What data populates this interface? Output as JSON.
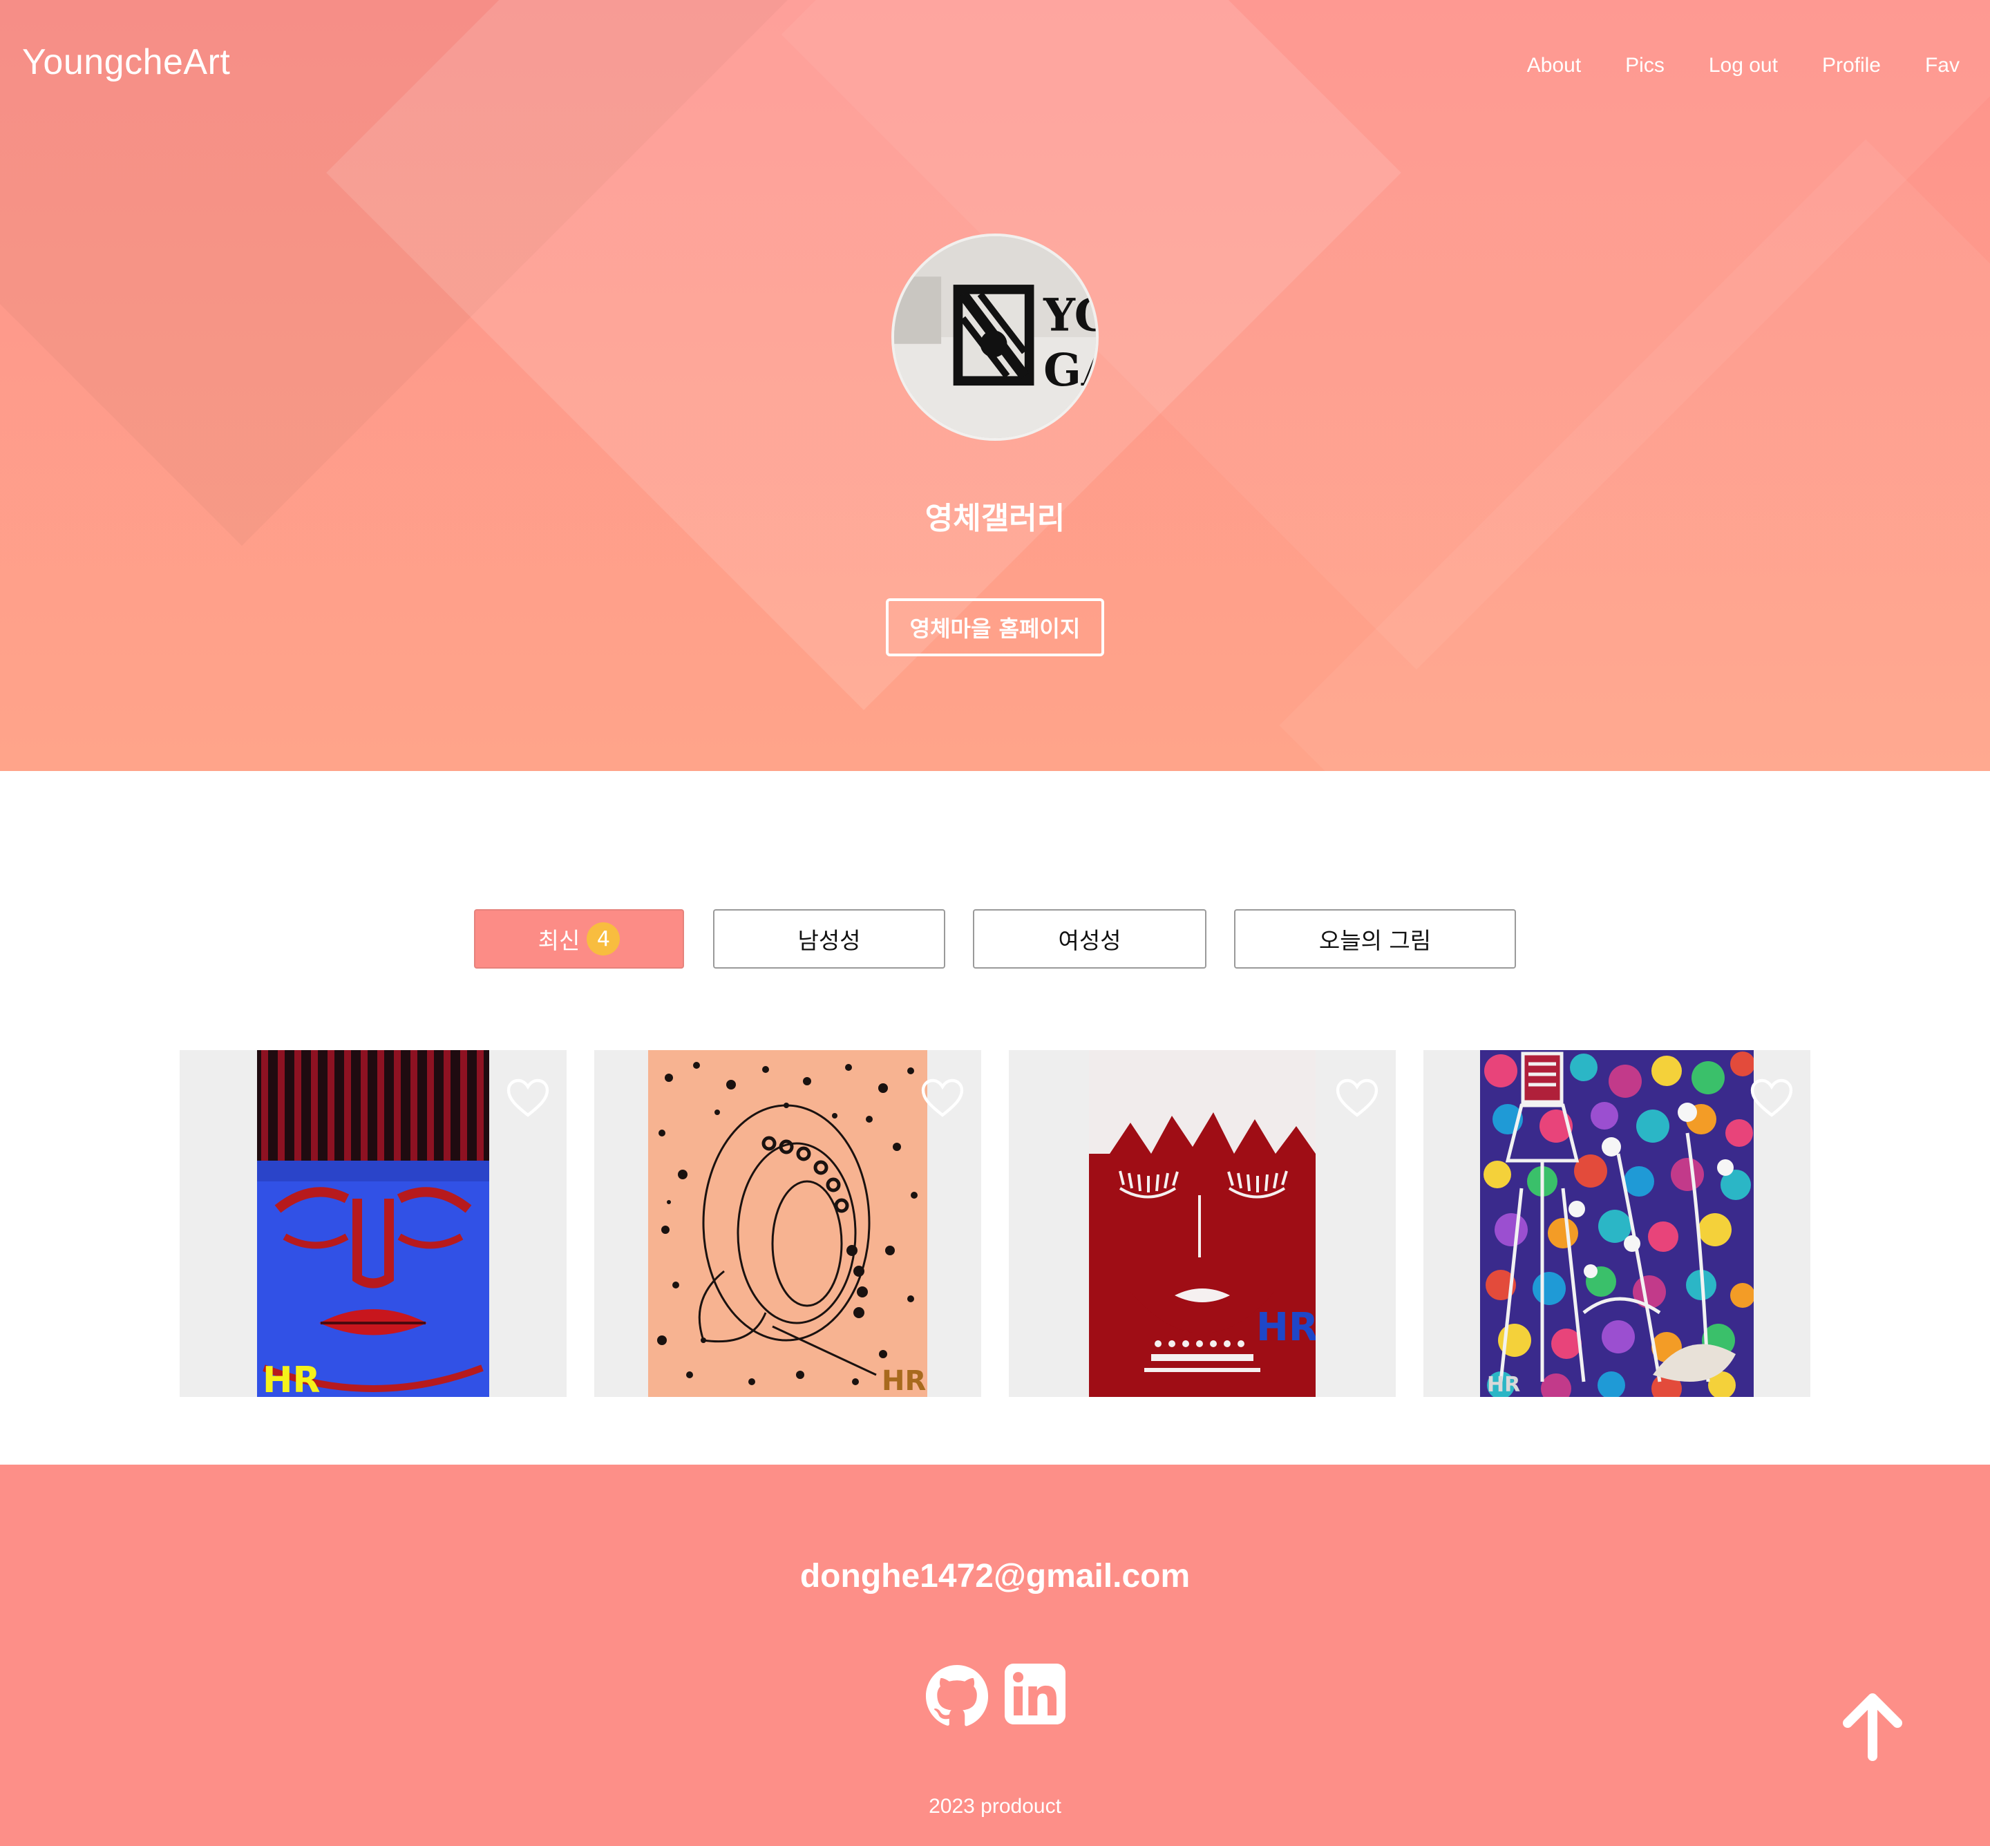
{
  "header": {
    "brand": "YoungcheArt",
    "nav": [
      "About",
      "Pics",
      "Log out",
      "Profile",
      "Fav"
    ]
  },
  "profile": {
    "avatar_icon": "gallery-logo-icon",
    "avatar_text": [
      "YC",
      "GA"
    ],
    "name": "영체갤러리",
    "homepage_button": "영체마을 홈페이지"
  },
  "filters": [
    {
      "label": "최신",
      "count": "4",
      "active": true
    },
    {
      "label": "남성성",
      "active": false
    },
    {
      "label": "여성성",
      "active": false
    },
    {
      "label": "오늘의 그림",
      "active": false
    }
  ],
  "artworks": [
    {
      "signature": "HR",
      "liked": false
    },
    {
      "signature": "HR",
      "liked": false
    },
    {
      "signature": "HR",
      "liked": false
    },
    {
      "signature": "HR",
      "liked": false
    }
  ],
  "footer": {
    "email": "donghe1472@gmail.com",
    "social_icons": [
      "github-icon",
      "linkedin-icon"
    ],
    "copyright": "2023 prodouct",
    "scroll_top_icon": "arrow-up-icon"
  },
  "colors": {
    "hero_top": "#fe938c",
    "hero_bottom": "#ffa48a",
    "active_tab": "#fc8c86",
    "badge": "#f8bd3f",
    "footer": "#fd8f88"
  }
}
